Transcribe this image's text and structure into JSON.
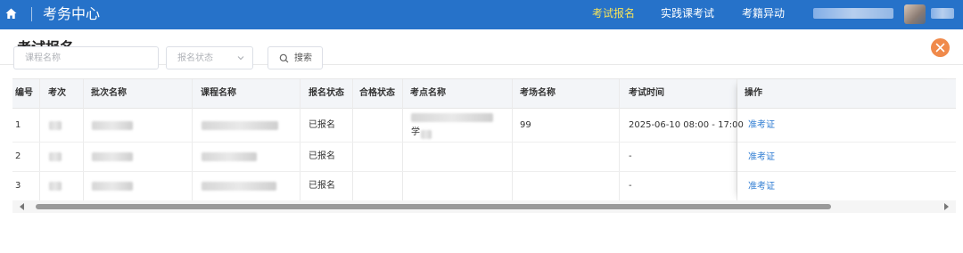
{
  "topbar": {
    "title": "考务中心",
    "nav": [
      {
        "label": "考试报名",
        "active": true
      },
      {
        "label": "实践课考试",
        "active": false
      },
      {
        "label": "考籍异动",
        "active": false
      }
    ],
    "icons": {
      "home": "home-icon",
      "user": "avatar"
    }
  },
  "panel": {
    "title": "考试报名",
    "close_icon": "close-icon"
  },
  "filters": {
    "course_placeholder": "课程名称",
    "status_placeholder": "报名状态",
    "search_label": "搜索"
  },
  "table": {
    "columns": [
      "编号",
      "考次",
      "批次名称",
      "课程名称",
      "报名状态",
      "合格状态",
      "考点名称",
      "考场名称",
      "考试时间",
      "操作"
    ],
    "rows": [
      {
        "no": "1",
        "status": "已报名",
        "room": "99",
        "time": "2025-06-10 08:00 - 17:00",
        "action": "准考证",
        "site_suffix": "学"
      },
      {
        "no": "2",
        "status": "已报名",
        "room": "",
        "time": "-",
        "action": "准考证",
        "site_suffix": ""
      },
      {
        "no": "3",
        "status": "已报名",
        "room": "",
        "time": "-",
        "action": "准考证",
        "site_suffix": ""
      }
    ]
  },
  "colors": {
    "topbar": "#2672c9",
    "active_nav": "#f6e35a",
    "link": "#2d7bd2",
    "close": "#f08a4b"
  }
}
